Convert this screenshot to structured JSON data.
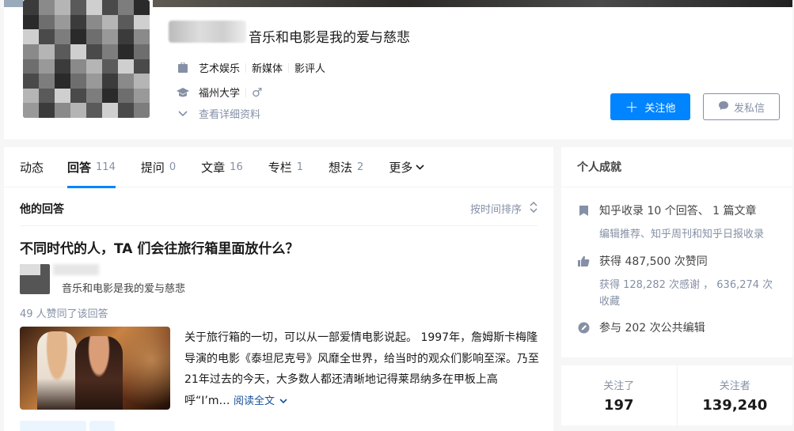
{
  "profile": {
    "headline": "音乐和电影是我的爱与慈悲",
    "industry": [
      "艺术娱乐",
      "新媒体",
      "影评人"
    ],
    "school": "福州大学",
    "gender_icon": "♂",
    "more_info_label": "查看详细资料",
    "follow_label": "关注他",
    "message_label": "发私信"
  },
  "tabs": [
    {
      "label": "动态",
      "count": ""
    },
    {
      "label": "回答",
      "count": "114"
    },
    {
      "label": "提问",
      "count": "0"
    },
    {
      "label": "文章",
      "count": "16"
    },
    {
      "label": "专栏",
      "count": "1"
    },
    {
      "label": "想法",
      "count": "2"
    },
    {
      "label": "更多",
      "count": ""
    }
  ],
  "answers": {
    "section_title": "他的回答",
    "sort_label": "按时间排序",
    "question": "不同时代的人，TA 们会往旅行箱里面放什么？",
    "author_headline": "音乐和电影是我的爱与慈悲",
    "votes_text": "49 人赞同了该回答",
    "excerpt": "关于旅行箱的一切，可以从一部爱情电影说起。 1997年，詹姆斯卡梅隆导演的电影《泰坦尼克号》风靡全世界，给当时的观众们影响至深。乃至21年过去的今天，大多数人都还清晰地记得莱昂纳多在甲板上高呼“I’m…",
    "read_more": "阅读全文"
  },
  "achievements": {
    "title": "个人成就",
    "included": "知乎收录 10 个回答、 1 篇文章",
    "included_sub": "编辑推荐、知乎周刊和知乎日报收录",
    "likes": "获得 487,500 次赞同",
    "likes_sub": "获得 128,282 次感谢 ， 636,274 次收藏",
    "edits": "参与 202 次公共编辑"
  },
  "stats": {
    "following_label": "关注了",
    "following": "197",
    "followers_label": "关注者",
    "followers": "139,240"
  },
  "colors": {
    "accent": "#0084ff",
    "muted": "#8590a6",
    "link": "#175199"
  }
}
